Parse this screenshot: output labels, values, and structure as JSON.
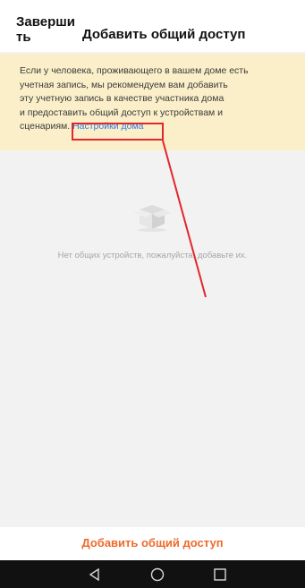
{
  "header": {
    "finish_label": "Заверши ть",
    "title": "Добавить общий доступ"
  },
  "notice": {
    "lines": [
      "Если у человека, проживающего в вашем доме есть",
      "учетная запись, мы рекомендуем вам добавить",
      "эту учетную запись в качестве участника дома",
      "и предоставить общий доступ к устройствам и"
    ],
    "last_line_prefix": "сценариям.",
    "link_label": "Настройки дома"
  },
  "empty_state": {
    "icon": "empty-box-icon",
    "text": "Нет общих устройств, пожалуйста, добавьте их."
  },
  "bottom": {
    "add_button_label": "Добавить общий доступ"
  },
  "navbar": {
    "icons": [
      "back-triangle-icon",
      "home-circle-icon",
      "recent-square-icon"
    ]
  },
  "colors": {
    "notice_bg": "#fbefc9",
    "link": "#2f7de1",
    "accent": "#ef6a2b",
    "annotation": "#e3262e"
  }
}
